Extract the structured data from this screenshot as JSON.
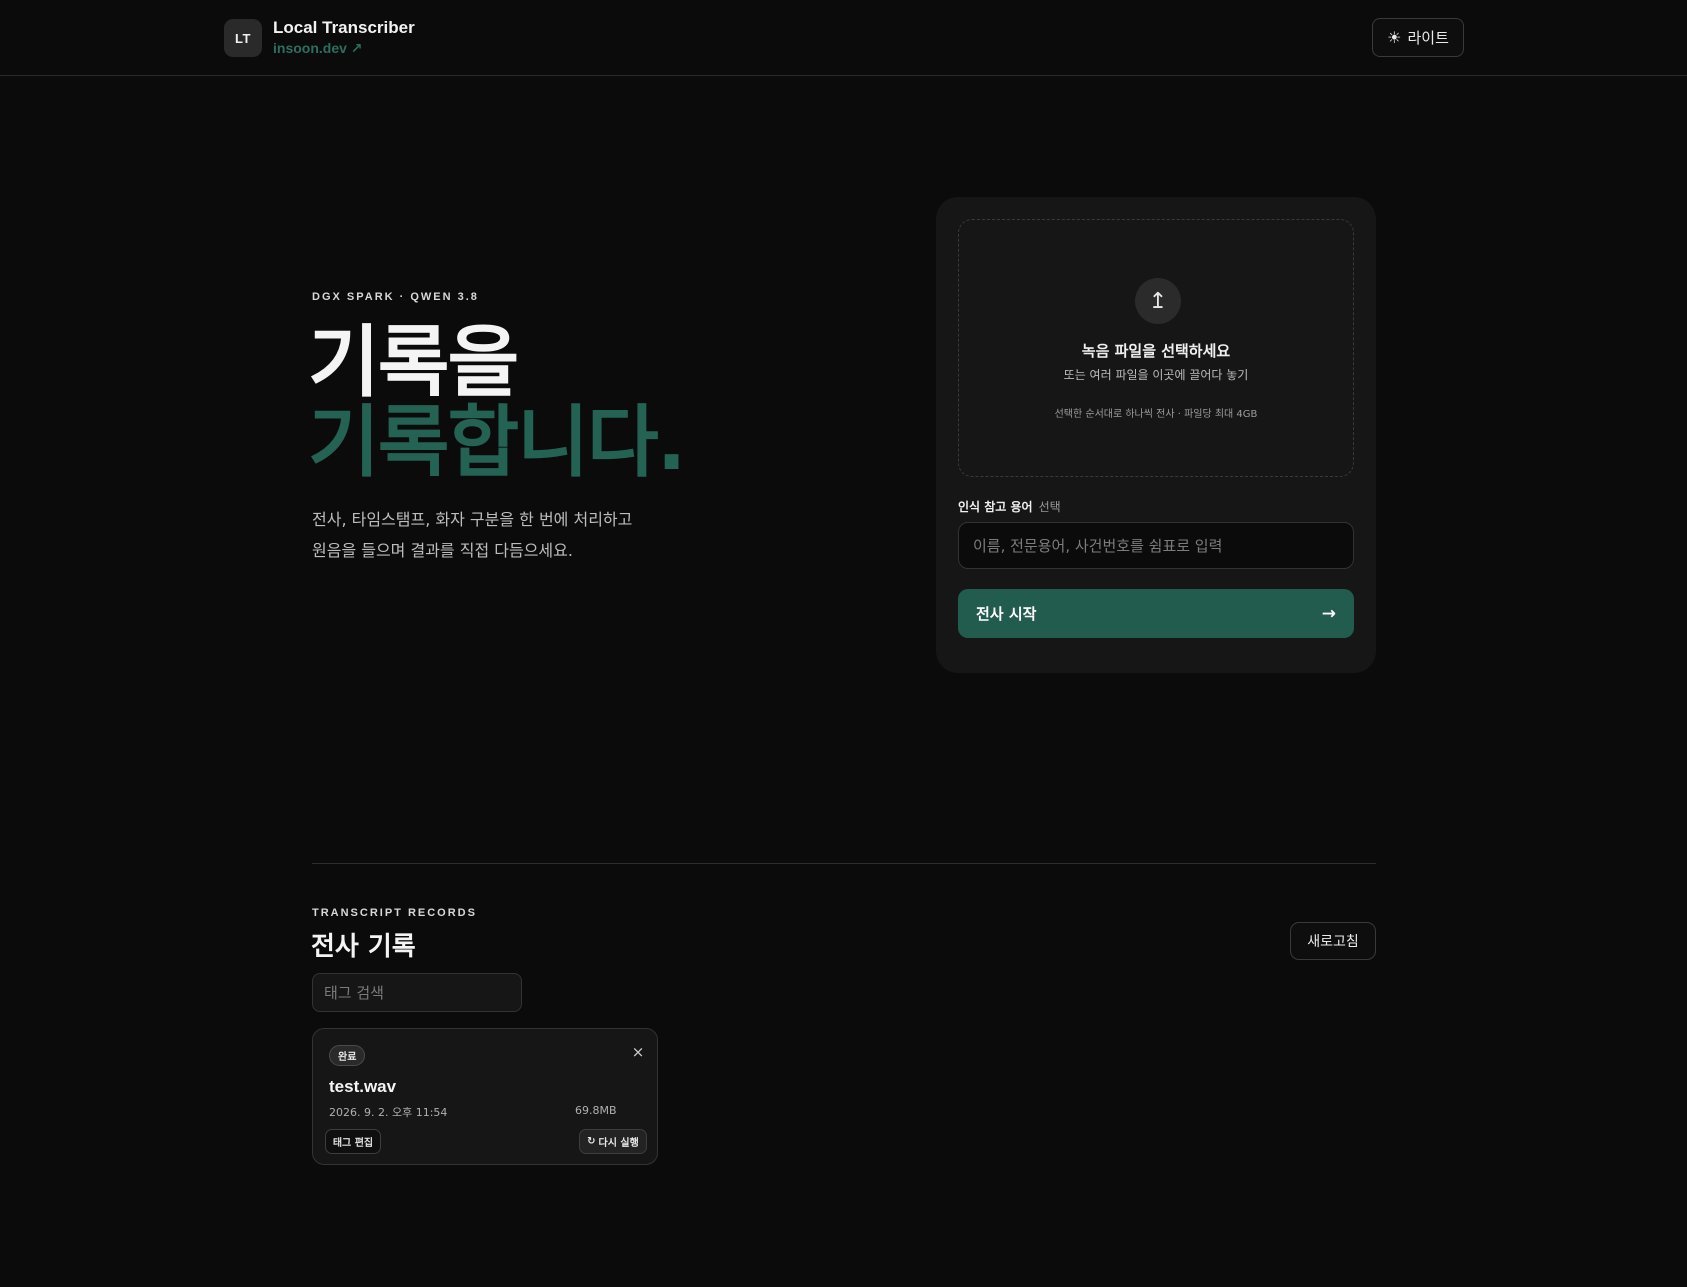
{
  "header": {
    "logo_initials": "LT",
    "app_title": "Local Transcriber",
    "site_link": "insoon.dev ↗",
    "theme_icon": "☀",
    "theme_label": "라이트"
  },
  "hero": {
    "eyebrow": "DGX SPARK · QWEN 3.8",
    "line1": "기록을",
    "line2": "기록합니다.",
    "desc_line1": "전사, 타임스탬프, 화자 구분을 한 번에 처리하고",
    "desc_line2": "원음을 들으며 결과를 직접 다듬으세요."
  },
  "upload": {
    "icon": "↥",
    "title": "녹음 파일을 선택하세요",
    "subtitle": "또는 여러 파일을 이곳에 끌어다 놓기",
    "note": "선택한 순서대로 하나씩 전사 · 파일당 최대 4GB",
    "terms_label": "인식 참고 용어",
    "terms_optional": "선택",
    "terms_placeholder": "이름, 전문용어, 사건번호를 쉼표로 입력",
    "start_label": "전사 시작",
    "start_icon": "→"
  },
  "records": {
    "eyebrow": "TRANSCRIPT RECORDS",
    "title": "전사 기록",
    "refresh_label": "새로고침",
    "search_placeholder": "태그 검색",
    "items": [
      {
        "status": "완료",
        "close_icon": "×",
        "file_name": "test.wav",
        "date": "2026. 9. 2. 오후 11:54",
        "size": "69.8MB",
        "tag_edit_label": "태그 편집",
        "rerun_icon": "↻",
        "rerun_label": "다시 실행"
      }
    ]
  },
  "colors": {
    "accent": "#225c4f",
    "accent_text": "#2d6e5e",
    "background": "#0b0b0b",
    "card": "#161616"
  }
}
